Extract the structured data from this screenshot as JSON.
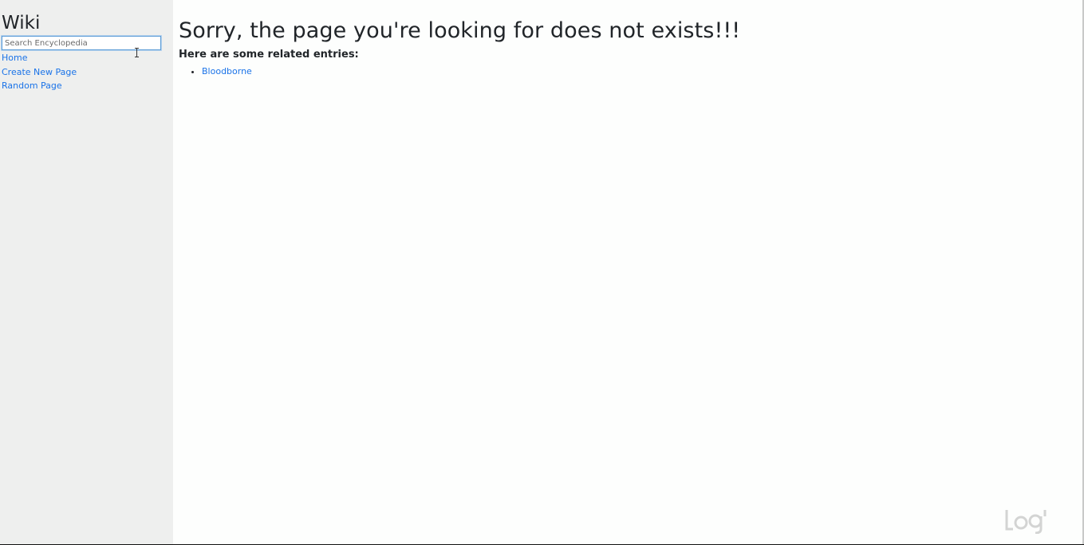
{
  "sidebar": {
    "title": "Wiki",
    "search": {
      "placeholder": "Search Encyclopedia",
      "value": ""
    },
    "links": [
      {
        "label": "Home"
      },
      {
        "label": "Create New Page"
      },
      {
        "label": "Random Page"
      }
    ]
  },
  "main": {
    "heading": "Sorry, the page you're looking for does not exists!!!",
    "subheading": "Here are some related entries:",
    "entries": [
      {
        "label": "Bloodborne"
      }
    ]
  },
  "colors": {
    "sidebar_bg": "#eeefee",
    "link": "#1a73e8",
    "text": "#212529",
    "search_border": "#5b9bd6"
  },
  "icons": {
    "cursor": "text-cursor-icon",
    "watermark": "logo-watermark-icon"
  }
}
